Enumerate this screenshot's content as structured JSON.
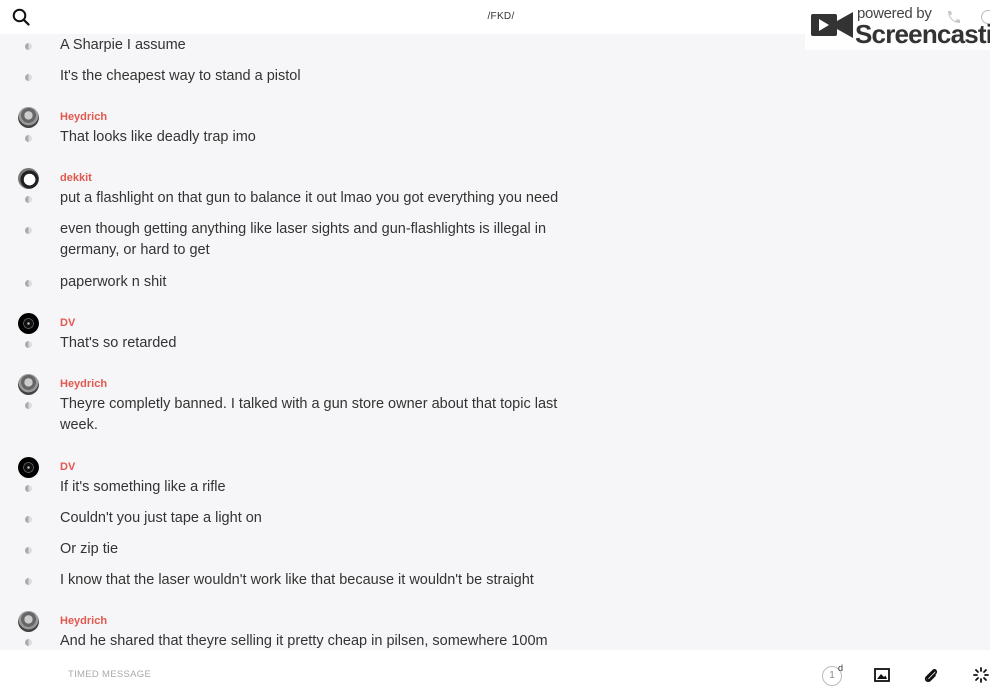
{
  "header": {
    "channel_title": "/FKD/",
    "search_icon": "search-icon"
  },
  "watermark": {
    "powered_by": "powered by",
    "brand": "Screencastify"
  },
  "messages": [
    {
      "type": "text",
      "text": "A Sharpie I assume"
    },
    {
      "type": "text",
      "text": "It's the cheapest way to stand a pistol"
    },
    {
      "type": "sender",
      "name": "Heydrich",
      "avatar": "avatar-heydrich"
    },
    {
      "type": "text",
      "text": "That looks like deadly trap imo"
    },
    {
      "type": "sender",
      "name": "dekkit",
      "avatar": "avatar-dekkit"
    },
    {
      "type": "text",
      "text": "put a flashlight on that gun to balance it out lmao you got everything you need"
    },
    {
      "type": "text",
      "text": "even though getting anything like laser sights and gun-flashlights is illegal in germany, or hard to get"
    },
    {
      "type": "text",
      "text": "paperwork n shit"
    },
    {
      "type": "sender",
      "name": "DV",
      "avatar": "avatar-dv"
    },
    {
      "type": "text",
      "text": "That's so retarded"
    },
    {
      "type": "sender",
      "name": "Heydrich",
      "avatar": "avatar-heydrich"
    },
    {
      "type": "text",
      "text": "Theyre completly banned. I talked with a gun store owner about that topic last week."
    },
    {
      "type": "sender",
      "name": "DV",
      "avatar": "avatar-dv"
    },
    {
      "type": "text",
      "text": "If it's something like a rifle"
    },
    {
      "type": "text",
      "text": "Couldn't you just tape a light on"
    },
    {
      "type": "text",
      "text": "Or zip tie"
    },
    {
      "type": "text",
      "text": "I know that the laser wouldn't work like that because it wouldn't be straight"
    },
    {
      "type": "sender",
      "name": "Heydrich",
      "avatar": "avatar-heydrich"
    },
    {
      "type": "text",
      "text": "And he shared that theyre selling it pretty cheap in pilsen, somewhere 100m"
    }
  ],
  "composer": {
    "timed_label": "TIMED MESSAGE",
    "ttl_value": "1",
    "ttl_unit": "d",
    "icons": [
      "image-icon",
      "paperclip-icon",
      "loading-icon"
    ]
  },
  "colors": {
    "sender": "#e0584e",
    "background": "#f6f6f8"
  }
}
